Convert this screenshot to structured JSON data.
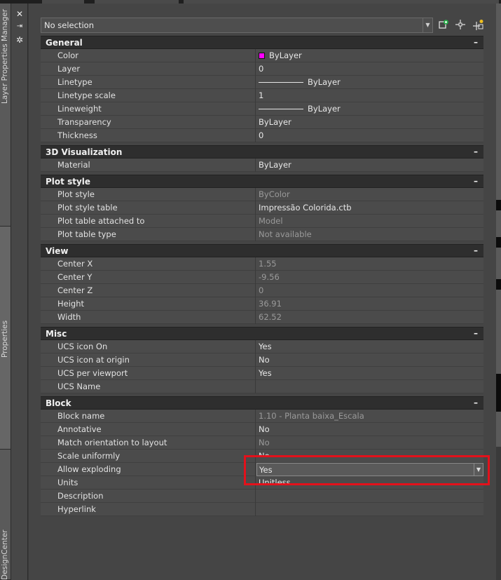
{
  "left_tabs": [
    "Layer Properties Manager",
    "Properties",
    "DesignCenter"
  ],
  "titlebar_icons": [
    "close-icon",
    "autohide-icon",
    "settings-icon"
  ],
  "selector": {
    "value": "No selection"
  },
  "toolbar_icons": [
    "quick-select-icon",
    "select-objects-icon",
    "toggle-pickadd-icon"
  ],
  "categories": [
    {
      "name": "General",
      "toggle": "–",
      "rows": [
        {
          "name": "Color",
          "value": "ByLayer",
          "swatch": "#ff00ff"
        },
        {
          "name": "Layer",
          "value": "0"
        },
        {
          "name": "Linetype",
          "value": "ByLayer",
          "line": true
        },
        {
          "name": "Linetype scale",
          "value": "1"
        },
        {
          "name": "Lineweight",
          "value": "ByLayer",
          "line": true
        },
        {
          "name": "Transparency",
          "value": "ByLayer"
        },
        {
          "name": "Thickness",
          "value": "0"
        }
      ]
    },
    {
      "name": "3D Visualization",
      "toggle": "–",
      "rows": [
        {
          "name": "Material",
          "value": "ByLayer"
        }
      ]
    },
    {
      "name": "Plot style",
      "toggle": "–",
      "rows": [
        {
          "name": "Plot style",
          "value": "ByColor",
          "dim": true
        },
        {
          "name": "Plot style table",
          "value": "Impressão Colorida.ctb"
        },
        {
          "name": "Plot table attached to",
          "value": "Model",
          "dim": true
        },
        {
          "name": "Plot table type",
          "value": "Not available",
          "dim": true
        }
      ]
    },
    {
      "name": "View",
      "toggle": "–",
      "rows": [
        {
          "name": "Center X",
          "value": "1.55",
          "dim": true
        },
        {
          "name": "Center Y",
          "value": "-9.56",
          "dim": true
        },
        {
          "name": "Center Z",
          "value": "0",
          "dim": true
        },
        {
          "name": "Height",
          "value": "36.91",
          "dim": true
        },
        {
          "name": "Width",
          "value": "62.52",
          "dim": true
        }
      ]
    },
    {
      "name": "Misc",
      "toggle": "–",
      "rows": [
        {
          "name": "UCS icon On",
          "value": "Yes"
        },
        {
          "name": "UCS icon at origin",
          "value": "No"
        },
        {
          "name": "UCS per viewport",
          "value": "Yes"
        },
        {
          "name": "UCS Name",
          "value": ""
        }
      ]
    },
    {
      "name": "Block",
      "toggle": "–",
      "rows": [
        {
          "name": "Block name",
          "value": "1.10 - Planta baixa_Escala",
          "dim": true
        },
        {
          "name": "Annotative",
          "value": "No"
        },
        {
          "name": "Match orientation to layout",
          "value": "No",
          "dim": true
        },
        {
          "name": "Scale uniformly",
          "value": "No",
          "clip": true
        },
        {
          "name": "Allow exploding",
          "value": "Yes",
          "dropdown": true
        },
        {
          "name": "Units",
          "value": "Unitless",
          "clip": true
        },
        {
          "name": "Description",
          "value": ""
        },
        {
          "name": "Hyperlink",
          "value": ""
        }
      ]
    }
  ]
}
